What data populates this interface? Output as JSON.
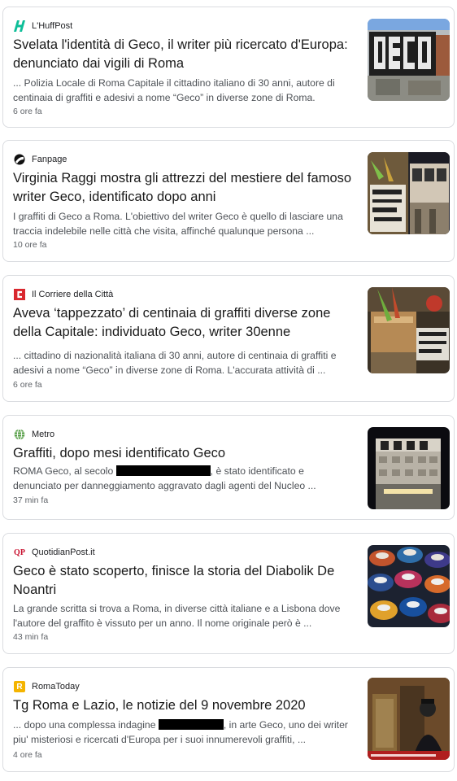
{
  "articles": [
    {
      "source": "L'HuffPost",
      "logo_icon": "huffpost-logo-icon",
      "headline": "Svelata l'identità di Geco, il writer più ricercato d'Europa: denunciato dai vigili di Roma",
      "snippet": "... Polizia Locale di Roma Capitale il cittadino italiano di 30 anni, autore di centinaia di graffiti e adesivi a nome “Geco” in diverse zone di Roma.",
      "time": "6 ore fa",
      "thumb_icon": "geco-wall-photo-icon"
    },
    {
      "source": "Fanpage",
      "logo_icon": "fanpage-logo-icon",
      "headline": "Virginia Raggi mostra gli attrezzi del mestiere del famoso writer Geco, identificato dopo anni",
      "snippet": "I graffiti di Geco a Roma. L'obiettivo del writer Geco è quello di lasciare una traccia indelebile nelle città che visita, affinché qualunque persona ...",
      "time": "10 ore fa",
      "thumb_icon": "graffiti-tools-photo-icon"
    },
    {
      "source": "Il Corriere della Città",
      "logo_icon": "corriere-citta-logo-icon",
      "headline": "Aveva ‘tappezzato’ di centinaia di graffiti diverse zone della Capitale: individuato Geco, writer 30enne",
      "snippet": "... cittadino di nazionalità italiana di 30 anni, autore di centinaia di graffiti e adesivi a nome “Geco” in diverse zone di Roma. L'accurata attività di ...",
      "time": "6 ore fa",
      "thumb_icon": "seized-materials-photo-icon"
    },
    {
      "source": "Metro",
      "logo_icon": "metro-globe-logo-icon",
      "headline": "Graffiti, dopo mesi identificato Geco",
      "snippet_before": "ROMA Geco, al secolo",
      "snippet_after": ", è stato identificato e denunciato per danneggiamento aggravato dagli agenti del Nucleo ...",
      "time": "37 min fa",
      "thumb_icon": "geco-building-night-photo-icon"
    },
    {
      "source": "QuotidianPost.it",
      "logo_icon": "quotidianpost-logo-icon",
      "logo_text": "QP",
      "headline": "Geco è stato scoperto, finisce la storia del Diabolik De Noantri",
      "snippet": "La grande scritta si trova a Roma, in diverse città italiane e a Lisbona dove l'autore del graffito è vissuto per un anno. Il nome originale però è ...",
      "time": "43 min fa",
      "thumb_icon": "spray-cans-photo-icon"
    },
    {
      "source": "RomaToday",
      "logo_icon": "romatoday-logo-icon",
      "logo_text": "R",
      "headline": "Tg Roma e Lazio, le notizie del 9 novembre 2020",
      "snippet_before": "... dopo una complessa indagine",
      "snippet_after": ", in arte Geco, uno dei writer piu' misteriosi e ricercati d'Europa per i suoi innumerevoli graffiti, ...",
      "time": "4 ore fa",
      "thumb_icon": "news-video-still-icon"
    }
  ],
  "colors": {
    "huffpost": "#0dbe98",
    "corriere": "#d9272e",
    "metro_globe": "#4e9a3e",
    "qp": "#c8102e",
    "romatoday": "#f4b400"
  }
}
